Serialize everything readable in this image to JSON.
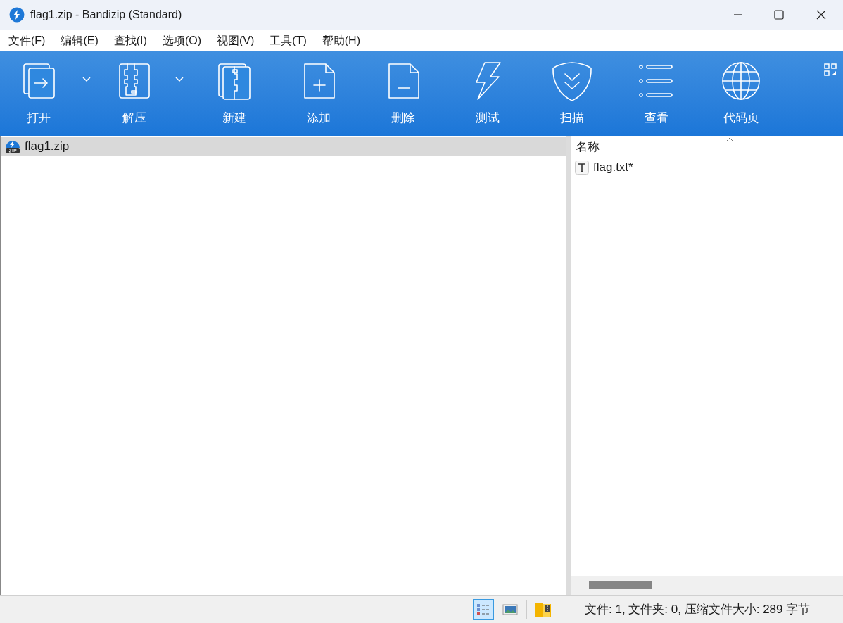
{
  "window": {
    "title": "flag1.zip - Bandizip (Standard)"
  },
  "menu": [
    "文件(F)",
    "编辑(E)",
    "查找(I)",
    "选项(O)",
    "视图(V)",
    "工具(T)",
    "帮助(H)"
  ],
  "toolbar": [
    {
      "label": "打开",
      "kind": "open",
      "dropdown": true
    },
    {
      "label": "解压",
      "kind": "extract",
      "dropdown": true
    },
    {
      "label": "新建",
      "kind": "new",
      "dropdown": false
    },
    {
      "label": "添加",
      "kind": "add",
      "dropdown": false
    },
    {
      "label": "删除",
      "kind": "delete",
      "dropdown": false
    },
    {
      "label": "测试",
      "kind": "test",
      "dropdown": false
    },
    {
      "label": "扫描",
      "kind": "scan",
      "dropdown": false
    },
    {
      "label": "查看",
      "kind": "view",
      "dropdown": false
    },
    {
      "label": "代码页",
      "kind": "codepage",
      "dropdown": false
    }
  ],
  "tree": [
    {
      "label": "flag1.zip",
      "selected": true
    }
  ],
  "file_list": {
    "column": "名称",
    "rows": [
      {
        "name": "flag.txt*",
        "selected": false
      }
    ]
  },
  "status_bar": {
    "views": [
      {
        "kind": "details",
        "selected": true
      },
      {
        "kind": "thumbnails",
        "selected": false
      }
    ],
    "text": "文件: 1, 文件夹: 0, 压缩文件大小: 289 字节"
  }
}
